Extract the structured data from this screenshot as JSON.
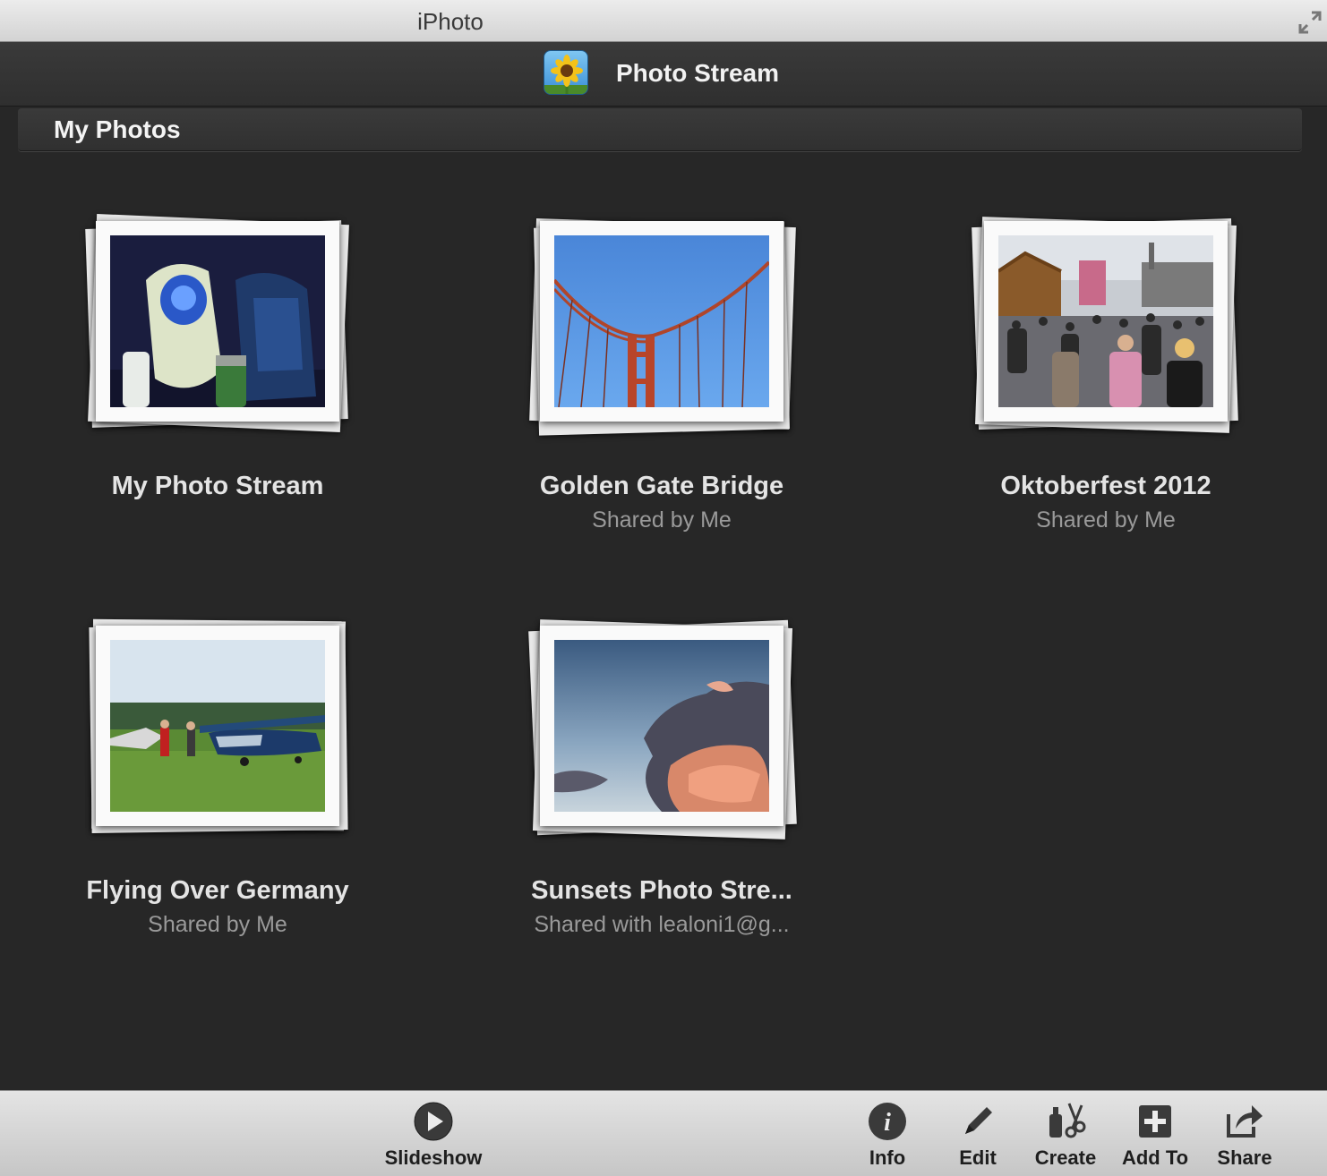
{
  "window": {
    "title": "iPhoto"
  },
  "header": {
    "title": "Photo Stream",
    "icon": "sunflower-icon"
  },
  "section": {
    "title": "My Photos"
  },
  "albums": [
    {
      "name": "My Photo Stream",
      "subtitle": ""
    },
    {
      "name": "Golden Gate Bridge",
      "subtitle": "Shared by Me"
    },
    {
      "name": "Oktoberfest 2012",
      "subtitle": "Shared by Me"
    },
    {
      "name": "Flying Over Germany",
      "subtitle": "Shared by Me"
    },
    {
      "name": "Sunsets Photo Stre...",
      "subtitle": "Shared with lealoni1@g..."
    }
  ],
  "toolbar": {
    "slideshow": "Slideshow",
    "info": "Info",
    "edit": "Edit",
    "create": "Create",
    "add_to": "Add To",
    "share": "Share"
  },
  "colors": {
    "background": "#272727",
    "header": "#333333",
    "toolbar": "#d4d4d4",
    "text_primary": "#e4e4e4",
    "text_secondary": "#9a9a9a"
  }
}
